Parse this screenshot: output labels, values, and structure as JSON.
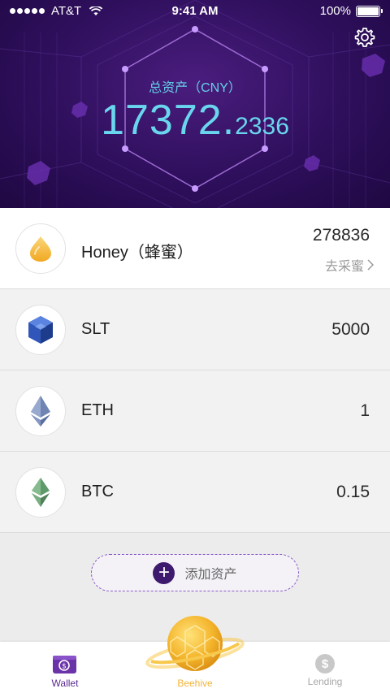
{
  "status_bar": {
    "carrier": "AT&T",
    "time": "9:41 AM",
    "battery": "100%"
  },
  "header": {
    "total_label": "总资产（CNY）",
    "total_integer": "17372.",
    "total_decimal": "2336"
  },
  "assets": [
    {
      "name": "Honey（蜂蜜）",
      "amount": "278836",
      "action": "去采蜜",
      "icon": "honey-drop-icon"
    },
    {
      "name": "SLT",
      "amount": "5000",
      "icon": "slt-cube-icon"
    },
    {
      "name": "ETH",
      "amount": "1",
      "icon": "eth-icon"
    },
    {
      "name": "BTC",
      "amount": "0.15",
      "icon": "btc-icon"
    }
  ],
  "add_asset": {
    "label": "添加资产"
  },
  "tabbar": {
    "wallet": "Wallet",
    "beehive": "Beehive",
    "lending": "Lending"
  },
  "colors": {
    "header_bg": "#2e0f5c",
    "accent_cyan": "#6ad6ee",
    "accent_purple": "#5a2a93",
    "beehive_gold": "#f1b43a"
  }
}
